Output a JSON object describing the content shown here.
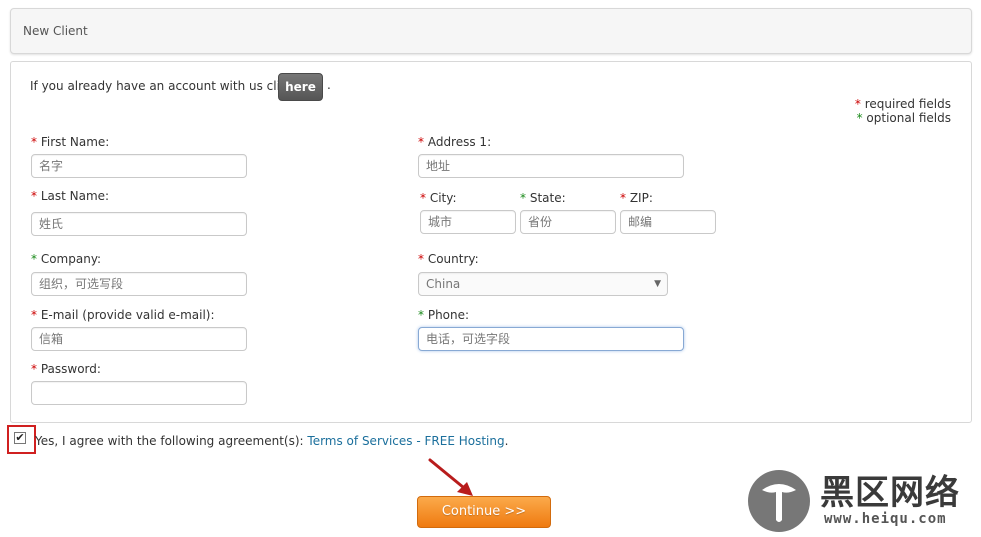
{
  "panel": {
    "title": "New Client"
  },
  "intro": {
    "text": "If you already have an account with us click",
    "here_label": "here",
    "period": "."
  },
  "legend": {
    "required": "required fields",
    "optional": "optional fields"
  },
  "form": {
    "first_name": {
      "label": "First Name:",
      "placeholder": "名字",
      "required": true
    },
    "last_name": {
      "label": "Last Name:",
      "placeholder": "姓氏",
      "required": true
    },
    "company": {
      "label": "Company:",
      "placeholder": "组织，可选写段",
      "required": false
    },
    "email": {
      "label": "E-mail (provide valid e-mail):",
      "placeholder": "信箱",
      "required": true
    },
    "password": {
      "label": "Password:",
      "placeholder": "",
      "required": true
    },
    "address1": {
      "label": "Address 1:",
      "placeholder": "地址",
      "required": true
    },
    "city": {
      "label": "City:",
      "placeholder": "城市",
      "required": true
    },
    "state": {
      "label": "State:",
      "placeholder": "省份",
      "required": false
    },
    "zip": {
      "label": "ZIP:",
      "placeholder": "邮编",
      "required": true
    },
    "country": {
      "label": "Country:",
      "value": "China",
      "required": true
    },
    "phone": {
      "label": "Phone:",
      "placeholder": "电话，可选字段",
      "required": false
    }
  },
  "agreement": {
    "checked": true,
    "text": "Yes, I agree with the following agreement(s):",
    "link": "Terms of Services - FREE Hosting",
    "period": "."
  },
  "continue_label": "Continue >>",
  "watermark": {
    "text": "黑区网络",
    "url": "www.heiqu.com"
  },
  "colors": {
    "required_star": "#cc0000",
    "optional_star": "#1a8a1a",
    "button_orange": "#f28a1e",
    "link": "#1b6f9c",
    "highlight": "#d02020"
  }
}
